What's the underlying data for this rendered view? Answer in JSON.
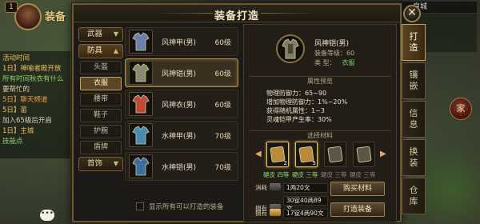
{
  "hud": {
    "level": "1",
    "player_name": "装备",
    "map_name": "皇城",
    "home_label": "家",
    "chat": [
      {
        "text": "活动时间",
        "cls": "gold"
      },
      {
        "text": "1日】神喻者殿开放",
        "cls": "gold"
      },
      {
        "text": "所有时间秋衣有什么",
        "cls": "green"
      },
      {
        "text": "要帮忙的",
        "cls": ""
      },
      {
        "text": "5日】聊天频道",
        "cls": "orange"
      },
      {
        "text": "5日】苗",
        "cls": "gold"
      },
      {
        "text": "加入65级后开启",
        "cls": ""
      },
      {
        "text": "1日】主城",
        "cls": "gold"
      },
      {
        "text": "技能点",
        "cls": "green"
      }
    ]
  },
  "window": {
    "title": "装备打造",
    "close_label": "✕"
  },
  "categories": [
    {
      "label": "武器",
      "type": "group",
      "chev": "▼"
    },
    {
      "label": "防具",
      "type": "group-open",
      "chev": "▲"
    },
    {
      "label": "头盔",
      "type": "sub"
    },
    {
      "label": "衣服",
      "type": "sub-active"
    },
    {
      "label": "腰带",
      "type": "sub"
    },
    {
      "label": "鞋子",
      "type": "sub"
    },
    {
      "label": "护腕",
      "type": "sub"
    },
    {
      "label": "盾牌",
      "type": "sub"
    },
    {
      "label": "首饰",
      "type": "group",
      "chev": "▼"
    }
  ],
  "items": [
    {
      "name": "风神甲(男)",
      "level": "60级",
      "color": "#6a7fb0"
    },
    {
      "name": "风神铠(男)",
      "level": "60级",
      "color": "#8a8a70",
      "selected": true
    },
    {
      "name": "风神衣(男)",
      "level": "60级",
      "color": "#c04a3a"
    },
    {
      "name": "水神甲(男)",
      "level": "70级",
      "color": "#4a8ab0"
    },
    {
      "name": "水神铠(男)",
      "level": "70级",
      "color": "#3a6fa0"
    }
  ],
  "show_all_label": "显示所有可以打造的装备",
  "detail": {
    "name": "风神铠(男)",
    "req_level": "装备等级：60",
    "type_label": "类    型：",
    "type_value": "衣服",
    "attr_header": "属性预览",
    "stats": [
      "物理防御力：65~90",
      "增加物理防御力：1%~20%",
      "获得随机属性：1~3",
      "灵魂铠甲产生率：30%"
    ],
    "material_header": "选择材料",
    "materials": [
      {
        "count": "2",
        "label": "硬皮 四等",
        "cls": "green",
        "active": true
      },
      {
        "count": "5",
        "label": "硬皮 三等",
        "cls": "green",
        "active": true
      },
      {
        "count": "",
        "label": "硬皮 三等",
        "cls": "gray",
        "active": false
      },
      {
        "count": "",
        "label": "硬皮 三等",
        "cls": "gray",
        "active": false
      }
    ],
    "costs": [
      {
        "label": "消耗",
        "value": "1两20文",
        "coin": "silver"
      },
      {
        "label": "拥有",
        "value": "30锭40两89文",
        "coin": "silver"
      },
      {
        "label": "拥有",
        "value": "17锭4两90文",
        "coin": "gold"
      }
    ],
    "buy_button": "购买材料",
    "craft_button": "打造装备"
  },
  "tabs": [
    {
      "label": "打造",
      "active": true
    },
    {
      "label": "镶嵌",
      "active": false
    },
    {
      "label": "信息",
      "active": false
    },
    {
      "label": "换装",
      "active": false
    },
    {
      "label": "仓库",
      "active": false
    }
  ]
}
